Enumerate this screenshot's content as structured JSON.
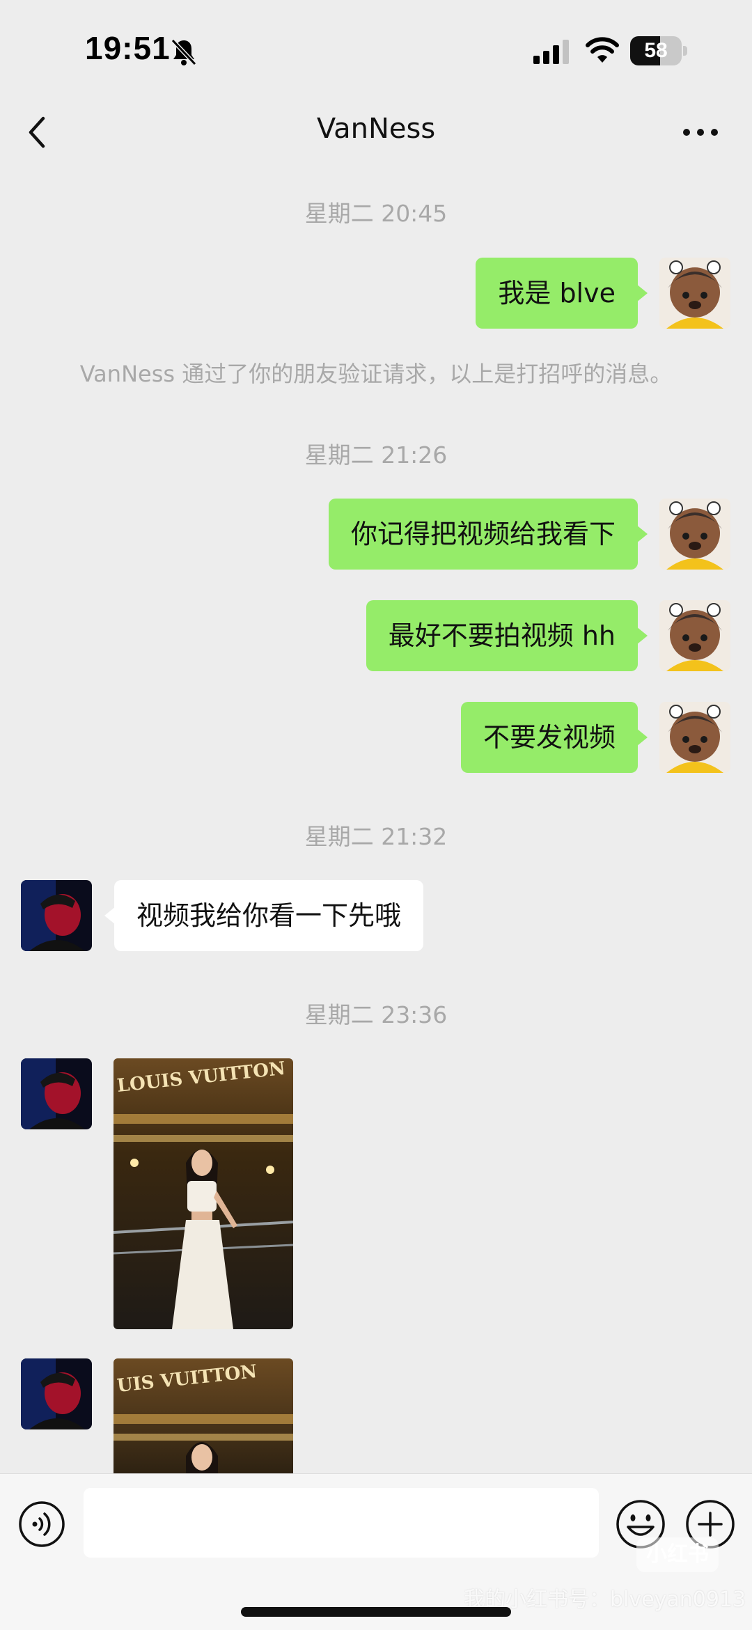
{
  "status_bar": {
    "time": "19:51",
    "battery": "58",
    "battery_level": 0.58,
    "icons": [
      "bell-muted-icon",
      "signal-icon",
      "wifi-icon",
      "battery-icon"
    ]
  },
  "header": {
    "title": "VanNess",
    "back_icon": "chevron-left-icon",
    "more_icon": "more-icon"
  },
  "messages": {
    "ts1": "星期二 20:45",
    "m1": "我是 blve",
    "note": "VanNess 通过了你的朋友验证请求，以上是打招呼的消息。",
    "ts2": "星期二 21:26",
    "m2": "你记得把视频给我看下",
    "m3": "最好不要拍视频 hh",
    "m4": "不要发视频",
    "ts3": "星期二 21:32",
    "m5": "视频我给你看一下先哦",
    "ts4": "星期二 23:36",
    "photo_sign": "LOUIS VUITTON",
    "photo_sign_2": "UIS VUITTON"
  },
  "input_bar": {
    "placeholder": "",
    "icons": [
      "voice-icon",
      "emoji-icon",
      "plus-icon"
    ]
  },
  "watermark": {
    "text": "我的小红书号：blveyan0913",
    "logo": "小红书"
  },
  "colors": {
    "outgoing_bubble": "#95ec69",
    "incoming_bubble": "#ffffff",
    "background": "#ededed",
    "meta_text": "#a8a8a8"
  }
}
